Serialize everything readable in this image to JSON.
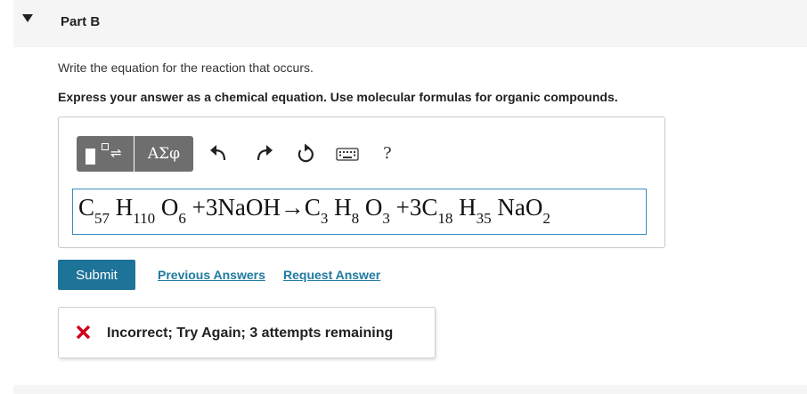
{
  "part": {
    "title": "Part B"
  },
  "question": {
    "instruction": "Write the equation for the reaction that occurs.",
    "format_instruction": "Express your answer as a chemical equation. Use molecular formulas for organic compounds."
  },
  "toolbar": {
    "symbols_label": "ΑΣφ",
    "help_label": "?"
  },
  "equation": {
    "parts": [
      {
        "type": "text",
        "v": "C"
      },
      {
        "type": "sub",
        "v": "57"
      },
      {
        "type": "text",
        "v": " H"
      },
      {
        "type": "sub",
        "v": "110"
      },
      {
        "type": "text",
        "v": " O"
      },
      {
        "type": "sub",
        "v": "6"
      },
      {
        "type": "text",
        "v": " +3NaOH→C"
      },
      {
        "type": "sub",
        "v": "3"
      },
      {
        "type": "text",
        "v": " H"
      },
      {
        "type": "sub",
        "v": "8"
      },
      {
        "type": "text",
        "v": " O"
      },
      {
        "type": "sub",
        "v": "3"
      },
      {
        "type": "text",
        "v": " +3C"
      },
      {
        "type": "sub",
        "v": "18"
      },
      {
        "type": "text",
        "v": " H"
      },
      {
        "type": "sub",
        "v": "35"
      },
      {
        "type": "text",
        "v": " NaO"
      },
      {
        "type": "sub",
        "v": "2"
      }
    ]
  },
  "actions": {
    "submit_label": "Submit",
    "previous_answers_label": "Previous Answers",
    "request_answer_label": "Request Answer"
  },
  "feedback": {
    "message": "Incorrect; Try Again; 3 attempts remaining",
    "icon": "x-icon",
    "color": "#d0021b"
  },
  "colors": {
    "primary": "#1e7399",
    "link": "#1f7aa0",
    "toolbar": "#6e6e6e",
    "field_border": "#3a8bbf"
  }
}
